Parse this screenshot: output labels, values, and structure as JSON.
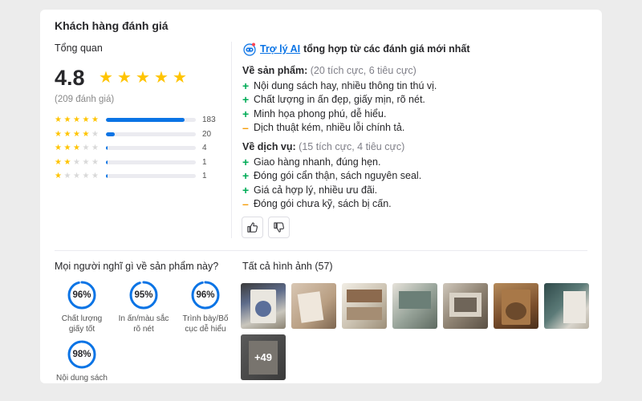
{
  "section_title": "Khách hàng đánh giá",
  "overview": {
    "label": "Tổng quan",
    "average": "4.8",
    "stars": 5,
    "total_reviews": "(209 đánh giá)",
    "distribution": [
      {
        "stars": 5,
        "count": "183",
        "fraction": 0.876
      },
      {
        "stars": 4,
        "count": "20",
        "fraction": 0.096
      },
      {
        "stars": 3,
        "count": "4",
        "fraction": 0.019
      },
      {
        "stars": 2,
        "count": "1",
        "fraction": 0.005
      },
      {
        "stars": 1,
        "count": "1",
        "fraction": 0.005
      }
    ]
  },
  "ai_summary": {
    "link": "Trợ lý AI",
    "text": "tổng hợp từ các đánh giá mới nhất",
    "product": {
      "heading": "Về sản phẩm:",
      "sub": "(20 tích cực, 6 tiêu cực)",
      "items": [
        {
          "sign": "+",
          "type": "plus",
          "text": "Nội dung sách hay, nhiều thông tin thú vị."
        },
        {
          "sign": "+",
          "type": "plus",
          "text": "Chất lượng in ấn đẹp, giấy mịn, rõ nét."
        },
        {
          "sign": "+",
          "type": "plus",
          "text": "Minh họa phong phú, dễ hiểu."
        },
        {
          "sign": "–",
          "type": "minus",
          "text": "Dịch thuật kém, nhiều lỗi chính tả."
        }
      ]
    },
    "service": {
      "heading": "Về dịch vụ:",
      "sub": "(15 tích cực, 4 tiêu cực)",
      "items": [
        {
          "sign": "+",
          "type": "plus",
          "text": "Giao hàng nhanh, đúng hẹn."
        },
        {
          "sign": "+",
          "type": "plus",
          "text": "Đóng gói cẩn thận, sách nguyên seal."
        },
        {
          "sign": "+",
          "type": "plus",
          "text": "Giá cả hợp lý, nhiều ưu đãi."
        },
        {
          "sign": "–",
          "type": "minus",
          "text": "Đóng gói chưa kỹ, sách bị cấn."
        }
      ]
    },
    "like_icon": "thumbs-up-icon",
    "dislike_icon": "thumbs-down-icon"
  },
  "opinions": {
    "title": "Mọi người nghĩ gì về sản phẩm này?",
    "items": [
      {
        "percent": "96%",
        "value": 0.96,
        "label": "Chất lượng giấy tốt"
      },
      {
        "percent": "95%",
        "value": 0.95,
        "label": "In ấn/màu sắc rõ nét"
      },
      {
        "percent": "96%",
        "value": 0.96,
        "label": "Trình bày/Bố cục dễ hiểu"
      },
      {
        "percent": "98%",
        "value": 0.98,
        "label": "Nội dung sách"
      }
    ]
  },
  "images": {
    "title": "Tất cả hình ảnh (57)",
    "more_label": "+49"
  },
  "colors": {
    "star": "#ffc400",
    "accent": "#0b74e5",
    "positive": "#00ab56",
    "negative": "#f59e0b"
  }
}
